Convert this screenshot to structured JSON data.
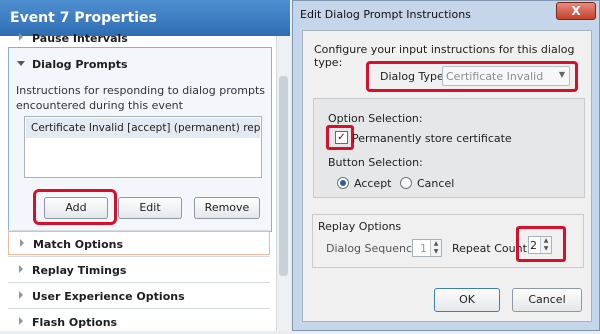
{
  "left_panel": {
    "title": "Event 7 Properties",
    "sections": {
      "pause": "Pause Intervals",
      "dialog_prompts": "Dialog Prompts",
      "match": "Match Options",
      "replay": "Replay Timings",
      "ux": "User Experience Options",
      "flash": "Flash Options"
    },
    "prompts_description": "Instructions for responding to dialog prompts encountered during this event",
    "prompts_list": [
      "Certificate Invalid  [accept]  (permanent)  repe..."
    ],
    "buttons": {
      "add": "Add",
      "edit": "Edit",
      "remove": "Remove"
    }
  },
  "dialog": {
    "title": "Edit Dialog Prompt Instructions",
    "close_label": "X",
    "instructions": "Configure your input instructions for this dialog type:",
    "dialog_type_label": "Dialog Type:",
    "dialog_type_value": "Certificate Invalid",
    "option_selection_label": "Option Selection:",
    "permanent_label": "Permanently store certificate",
    "permanent_checked": true,
    "button_selection_label": "Button Selection:",
    "accept_label": "Accept",
    "cancel_label": "Cancel",
    "selected_button": "Accept",
    "replay_options_label": "Replay Options",
    "dialog_sequence_label": "Dialog Sequence:",
    "dialog_sequence_value": "1",
    "repeat_count_label": "Repeat Count",
    "repeat_count_value": "2",
    "ok_label": "OK",
    "cancel_button_label": "Cancel"
  },
  "colors": {
    "accent": "#2f6db3",
    "highlight": "#d6102b"
  }
}
